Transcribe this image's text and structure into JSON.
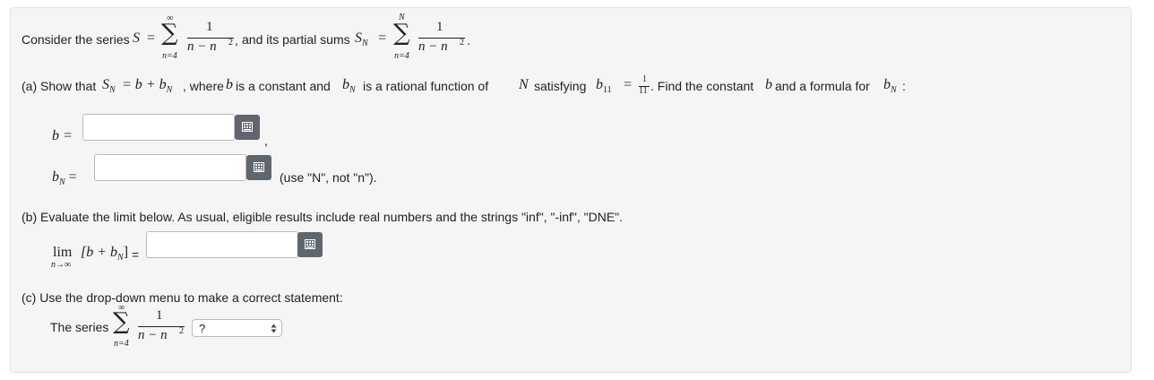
{
  "intro": {
    "prefix": "Consider the series",
    "S": "S",
    "eq": "=",
    "sum_upper": "∞",
    "sum_lower": "n=4",
    "numerator": "1",
    "denominator": "n − n",
    "exp": "2",
    "comma": ",",
    "middle": "and its partial sums",
    "SN_base": "S",
    "SN_sub": "N",
    "partial_upper": "N",
    "partial_lower": "n=4",
    "period": "."
  },
  "part_a": {
    "text_1": "(a) Show that",
    "SN_base": "S",
    "SN_sub": "N",
    "expr": "= b + b",
    "expr_sub": "N",
    "text_2": ", where",
    "b": "b",
    "text_3": "is a constant and",
    "bN_base": "b",
    "bN_sub": "N",
    "text_4": "is a rational function of",
    "N": "N",
    "text_5": "satisfying",
    "b11_base": "b",
    "b11_sub": "11",
    "b11_eq": "=",
    "frac_num": "1",
    "frac_den": "11",
    "text_6": ". Find the constant",
    "text_7": "and a formula for",
    "colon": ":",
    "b_label": "b =",
    "b_comma": ",",
    "bN_label_base": "b",
    "bN_label_sub": "N",
    "bN_label_eq": "=",
    "bN_input_value": "",
    "b_input_value": "",
    "hint": "(use \"N\", not \"n\")."
  },
  "part_b": {
    "text": "(b) Evaluate the limit below. As usual, eligible results include real numbers and the strings \"inf\", \"-inf\", \"DNE\".",
    "lim": "lim",
    "lim_sub": "n→∞",
    "expr_open": "[b + b",
    "expr_sub": "N",
    "expr_close": "]",
    "eq": "=",
    "input_value": ""
  },
  "part_c": {
    "text": "(c) Use the drop-down menu to make a correct statement:",
    "series_label": "The series",
    "select_value": "?"
  },
  "icons": {
    "keyboard": "keyboard-icon",
    "select_arrows": "updown-arrows-icon"
  }
}
